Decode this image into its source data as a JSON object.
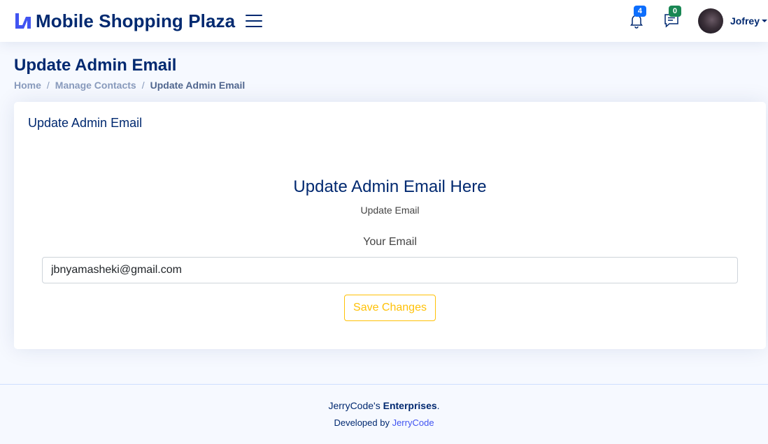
{
  "header": {
    "brand": "Mobile Shopping Plaza",
    "notifications_count": "4",
    "messages_count": "0",
    "user_name": "Jofrey"
  },
  "page": {
    "title": "Update Admin Email",
    "breadcrumb": [
      "Home",
      "Manage Contacts",
      "Update Admin Email"
    ]
  },
  "card": {
    "title": "Update Admin Email",
    "form_heading": "Update Admin Email Here",
    "form_subheading": "Update Email",
    "email_label": "Your Email",
    "email_value": "jbnyamasheki@gmail.com",
    "save_label": "Save Changes"
  },
  "footer": {
    "copyright_prefix": "JerryCode's ",
    "copyright_strong": "Enterprises",
    "copyright_suffix": ".",
    "credits_prefix": "Developed by ",
    "credits_link": "JerryCode"
  },
  "colors": {
    "primary": "#012970",
    "accent": "#4154f1",
    "warning": "#ffc107",
    "background": "#f6f9ff"
  },
  "icons": [
    "logo-icon",
    "menu-icon",
    "bell-icon",
    "chat-icon",
    "caret-down-icon"
  ]
}
